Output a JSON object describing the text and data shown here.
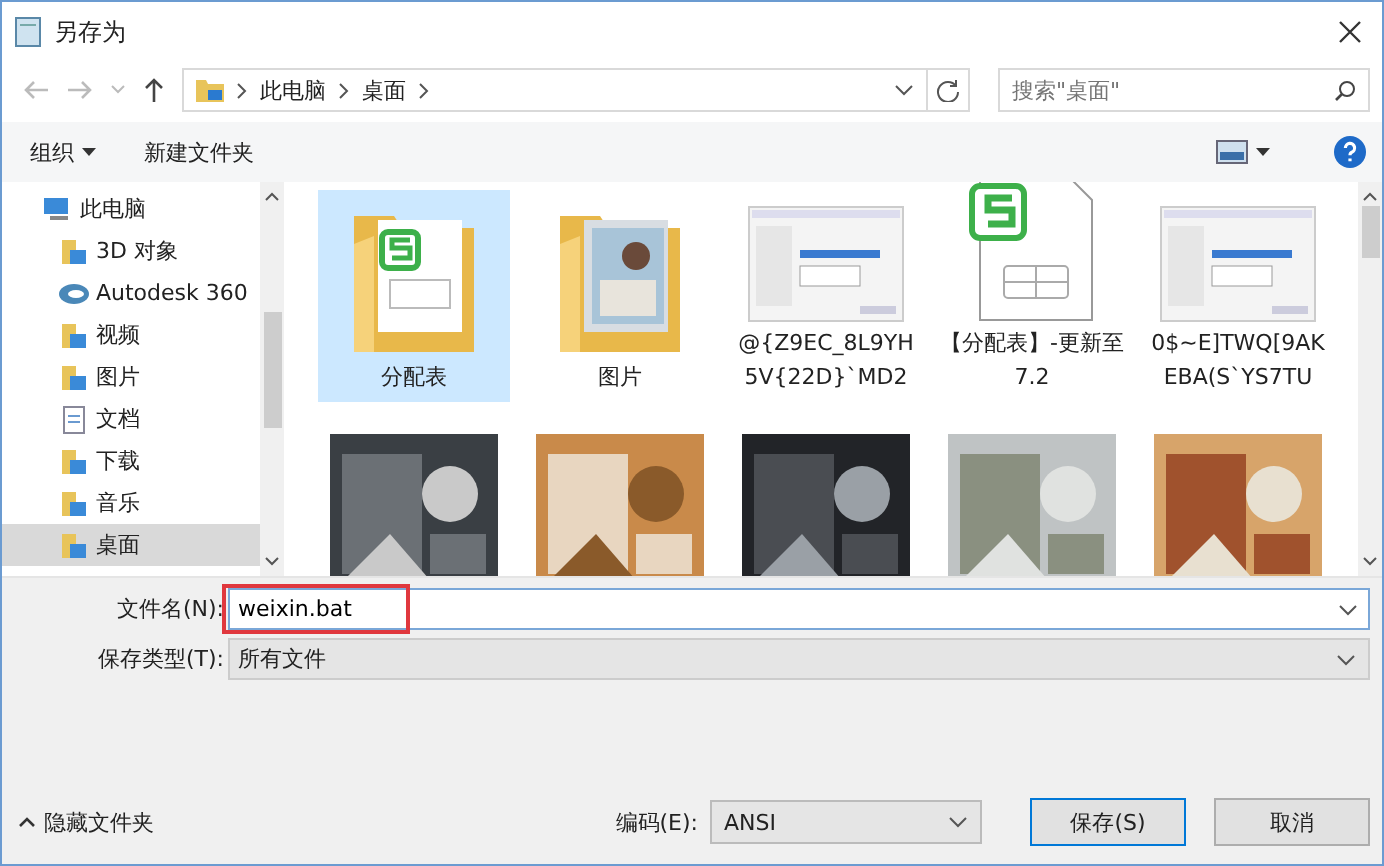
{
  "window": {
    "title": "另存为"
  },
  "nav": {
    "path": [
      "此电脑",
      "桌面"
    ],
    "search": {
      "placeholder": "搜索\"桌面\""
    }
  },
  "toolbar": {
    "organize": "组织",
    "new_folder": "新建文件夹"
  },
  "sidebar": {
    "items": [
      {
        "label": "此电脑",
        "kind": "pc",
        "selected": false,
        "children": [
          {
            "label": "3D 对象",
            "kind": "folder",
            "selected": false
          },
          {
            "label": "Autodesk 360",
            "kind": "cloud",
            "selected": false
          },
          {
            "label": "视频",
            "kind": "folder",
            "selected": false
          },
          {
            "label": "图片",
            "kind": "folder",
            "selected": false
          },
          {
            "label": "文档",
            "kind": "doc",
            "selected": false
          },
          {
            "label": "下载",
            "kind": "folder",
            "selected": false
          },
          {
            "label": "音乐",
            "kind": "folder",
            "selected": false
          },
          {
            "label": "桌面",
            "kind": "folder",
            "selected": true
          }
        ]
      }
    ]
  },
  "files": [
    {
      "name": "分配表",
      "kind": "folder",
      "selected": true
    },
    {
      "name": "图片",
      "kind": "folder",
      "selected": false
    },
    {
      "name": "@{Z9EC_8L9YH5V{22D}`MD2",
      "selected": false
    },
    {
      "name": "【分配表】-更新至7.2",
      "kind": "document",
      "selected": false
    },
    {
      "name": "0$~E]TWQ[9AKEBA(S`YS7TU",
      "selected": false
    },
    {
      "kind": "picture",
      "selected": false
    },
    {
      "kind": "picture",
      "selected": false
    },
    {
      "kind": "picture",
      "selected": false
    },
    {
      "kind": "picture",
      "selected": false
    },
    {
      "kind": "picture",
      "selected": false
    }
  ],
  "form": {
    "filename": {
      "label": "文件名(N):",
      "value": "weixin.bat"
    },
    "filetype": {
      "label": "保存类型(T):",
      "value": "所有文件"
    },
    "hide_folders": "隐藏文件夹",
    "encoding": {
      "label": "编码(E):",
      "value": "ANSI"
    },
    "buttons": [
      "保存(S)",
      "取消"
    ]
  }
}
